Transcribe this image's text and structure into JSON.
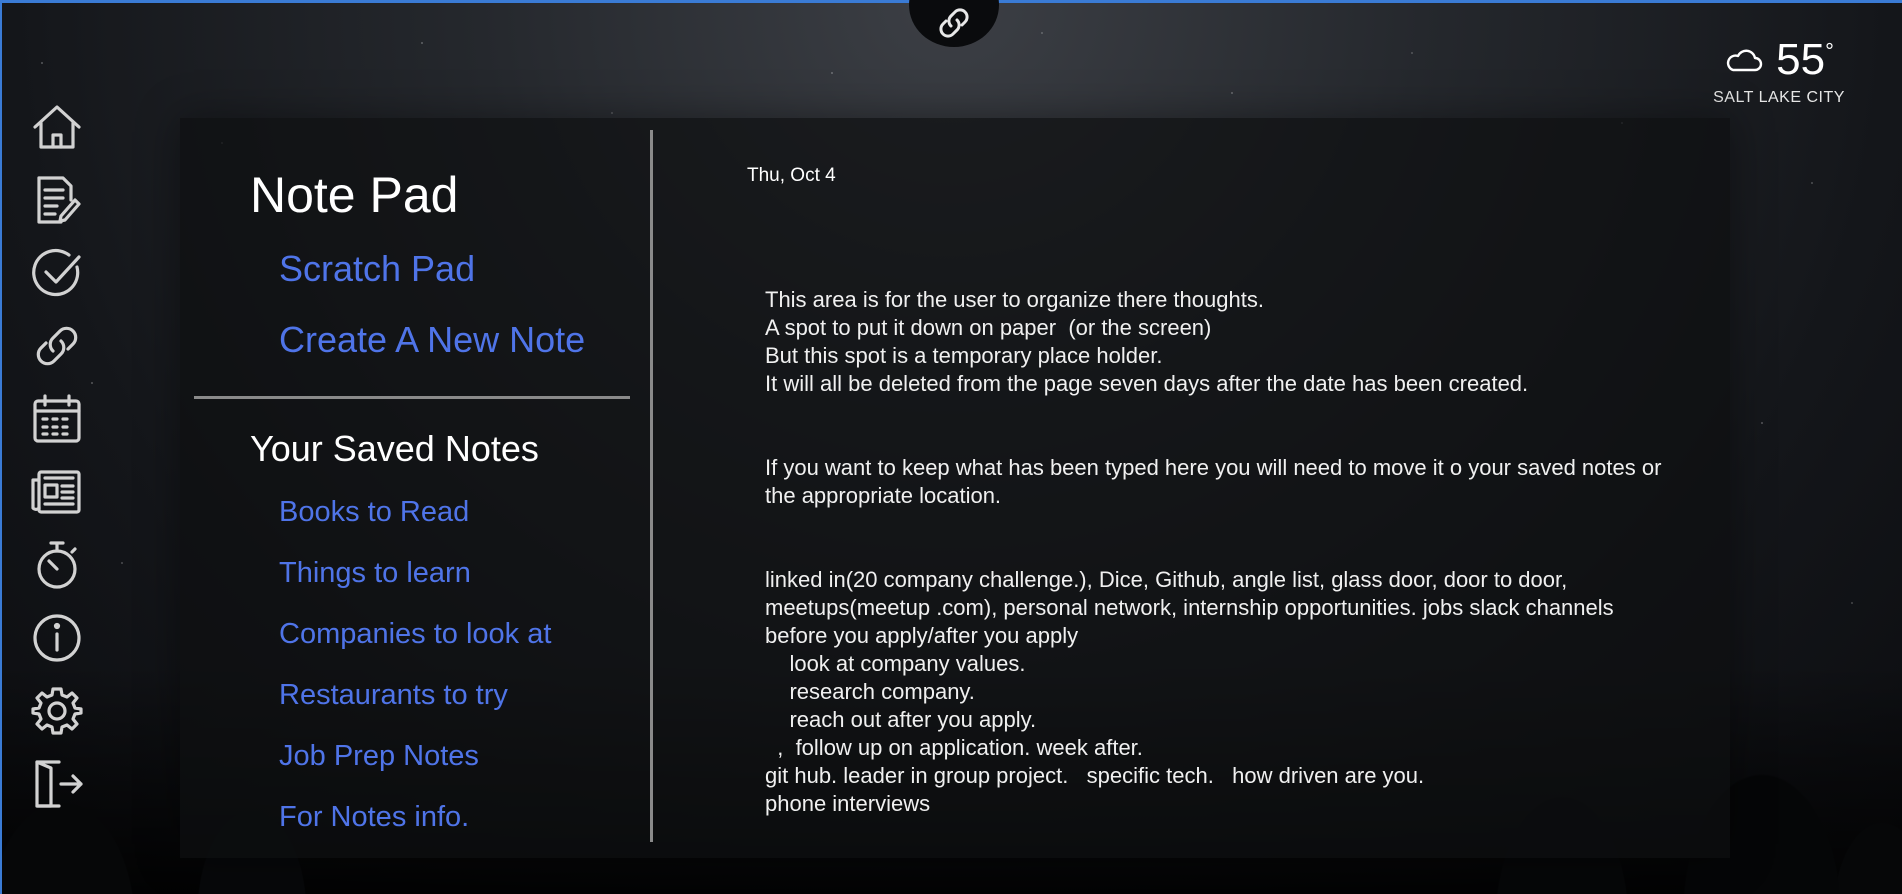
{
  "weather": {
    "temperature": "55",
    "unit_symbol": "°",
    "city": "SALT LAKE CITY",
    "icon": "cloud-icon"
  },
  "top_badge": {
    "icon": "link-icon"
  },
  "sidebar": {
    "items": [
      {
        "name": "home",
        "icon": "home-icon"
      },
      {
        "name": "notes",
        "icon": "note-edit-icon"
      },
      {
        "name": "tasks",
        "icon": "checkmark-icon"
      },
      {
        "name": "links",
        "icon": "link-icon"
      },
      {
        "name": "calendar",
        "icon": "calendar-icon"
      },
      {
        "name": "news",
        "icon": "newspaper-icon"
      },
      {
        "name": "timer",
        "icon": "stopwatch-icon"
      },
      {
        "name": "info",
        "icon": "info-icon"
      },
      {
        "name": "settings",
        "icon": "gear-icon"
      },
      {
        "name": "logout",
        "icon": "logout-icon"
      }
    ]
  },
  "notepad": {
    "title": "Note Pad",
    "scratch_pad_link": "Scratch Pad",
    "create_note_link": "Create A New Note",
    "saved_title": "Your Saved Notes",
    "saved_notes": [
      "Books to Read",
      "Things to learn",
      "Companies to look at",
      "Restaurants to try",
      "Job Prep Notes",
      "For Notes info."
    ]
  },
  "scratch": {
    "date": "Thu, Oct 4",
    "lines": [
      "This area is for the user to organize there thoughts.",
      "A spot to put it down on paper  (or the screen)",
      "But this spot is a temporary place holder.",
      "It will all be deleted from the page seven days after the date has been created.",
      "",
      "If you want to keep what has been typed here you will need to move it o your saved notes or the appropriate location.",
      "",
      "linked in(20 company challenge.), Dice, Github, angle list, glass door, door to door, meetups(meetup .com), personal network, internship opportunities. jobs slack channels",
      "before you apply/after you apply",
      "    look at company values.",
      "    research company.",
      "    reach out after you apply.",
      "  ,  follow up on application. week after.",
      "git hub. leader in group project.   specific tech.   how driven are you.",
      "phone interviews"
    ]
  }
}
